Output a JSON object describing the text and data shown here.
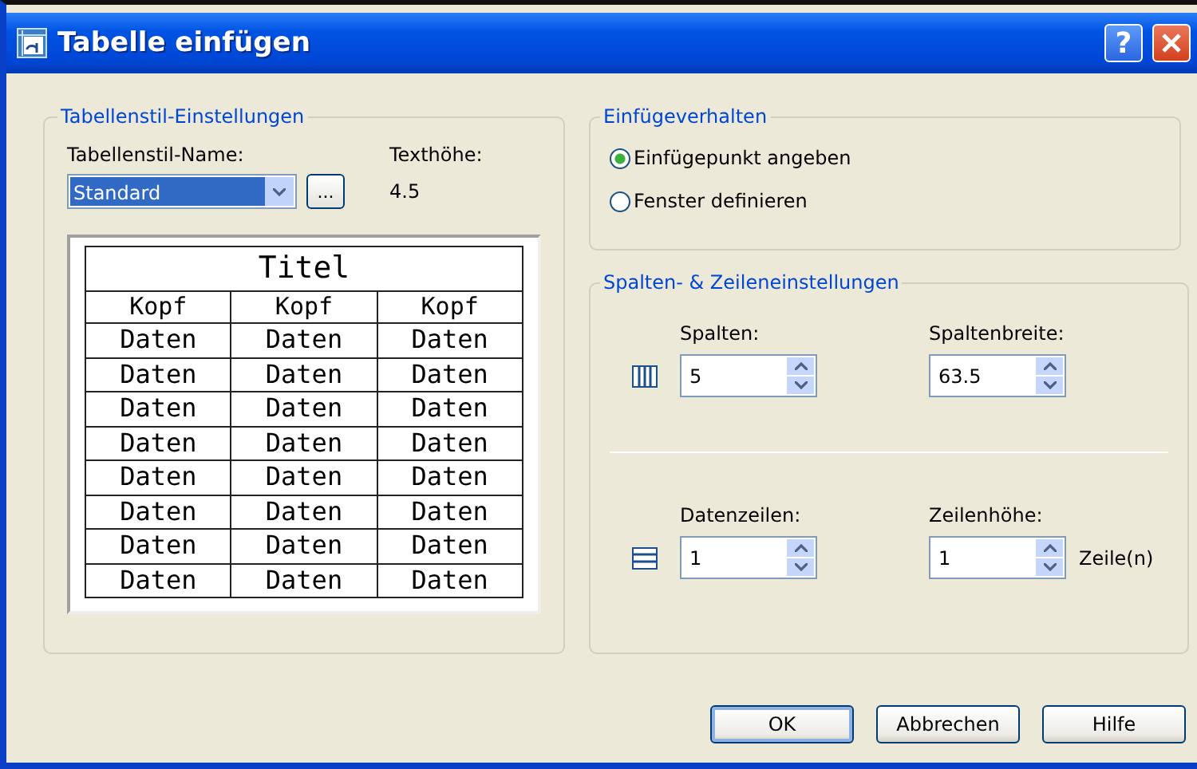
{
  "window": {
    "title": "Tabelle einfügen",
    "help_button": "?"
  },
  "table_style": {
    "legend": "Tabellenstil-Einstellungen",
    "name_label": "Tabellenstil-Name:",
    "name_value": "Standard",
    "browse_button": "...",
    "height_label": "Texthöhe:",
    "height_value": "4.5",
    "preview": {
      "title": "Titel",
      "headers": [
        "Kopf",
        "Kopf",
        "Kopf"
      ],
      "rows": [
        [
          "Daten",
          "Daten",
          "Daten"
        ],
        [
          "Daten",
          "Daten",
          "Daten"
        ],
        [
          "Daten",
          "Daten",
          "Daten"
        ],
        [
          "Daten",
          "Daten",
          "Daten"
        ],
        [
          "Daten",
          "Daten",
          "Daten"
        ],
        [
          "Daten",
          "Daten",
          "Daten"
        ],
        [
          "Daten",
          "Daten",
          "Daten"
        ],
        [
          "Daten",
          "Daten",
          "Daten"
        ]
      ]
    }
  },
  "insert_behavior": {
    "legend": "Einfügeverhalten",
    "options": [
      {
        "label": "Einfügepunkt angeben",
        "selected": true
      },
      {
        "label": "Fenster definieren",
        "selected": false
      }
    ]
  },
  "grid_settings": {
    "legend": "Spalten- & Zeileneinstellungen",
    "groups": [
      {
        "kind": "columns",
        "fields": [
          {
            "label": "Spalten:",
            "value": "5"
          },
          {
            "label": "Spaltenbreite:",
            "value": "63.5"
          }
        ]
      },
      {
        "kind": "rows",
        "fields": [
          {
            "label": "Datenzeilen:",
            "value": "1"
          },
          {
            "label": "Zeilenhöhe:",
            "value": "1",
            "unit": "Zeile(n)"
          }
        ]
      }
    ]
  },
  "buttons": [
    {
      "label": "OK",
      "default": true
    },
    {
      "label": "Abbrechen",
      "default": false
    },
    {
      "label": "Hilfe",
      "default": false
    }
  ]
}
